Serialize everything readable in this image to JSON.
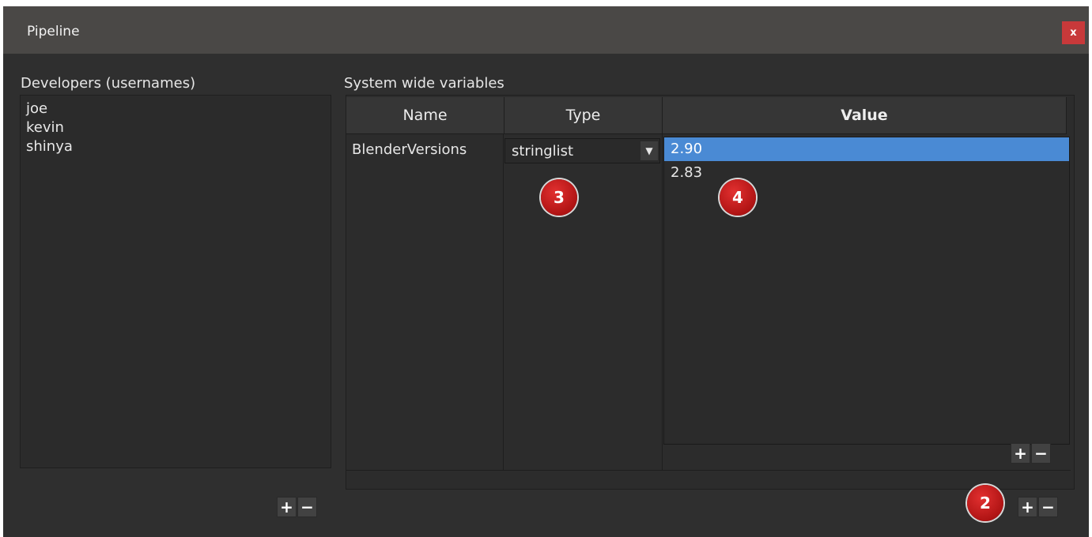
{
  "window": {
    "title": "Pipeline",
    "close_label": "x"
  },
  "developers": {
    "label": "Developers (usernames)",
    "items": [
      "joe",
      "kevin",
      "shinya"
    ],
    "add_label": "+",
    "remove_label": "−"
  },
  "variables": {
    "label": "System wide variables",
    "columns": [
      "Name",
      "Type",
      "Value"
    ],
    "row": {
      "name": "BlenderVersions",
      "type": "stringlist",
      "values": [
        "2.90",
        "2.83"
      ],
      "selected_value": "2.90"
    },
    "value_add_label": "+",
    "value_remove_label": "−",
    "add_label": "+",
    "remove_label": "−"
  },
  "badges": {
    "type_badge": "3",
    "value_badge": "4",
    "add_badge": "2"
  },
  "colors": {
    "selection": "#4a8ad4",
    "badge": "#c41a1a",
    "close": "#c8393a"
  }
}
